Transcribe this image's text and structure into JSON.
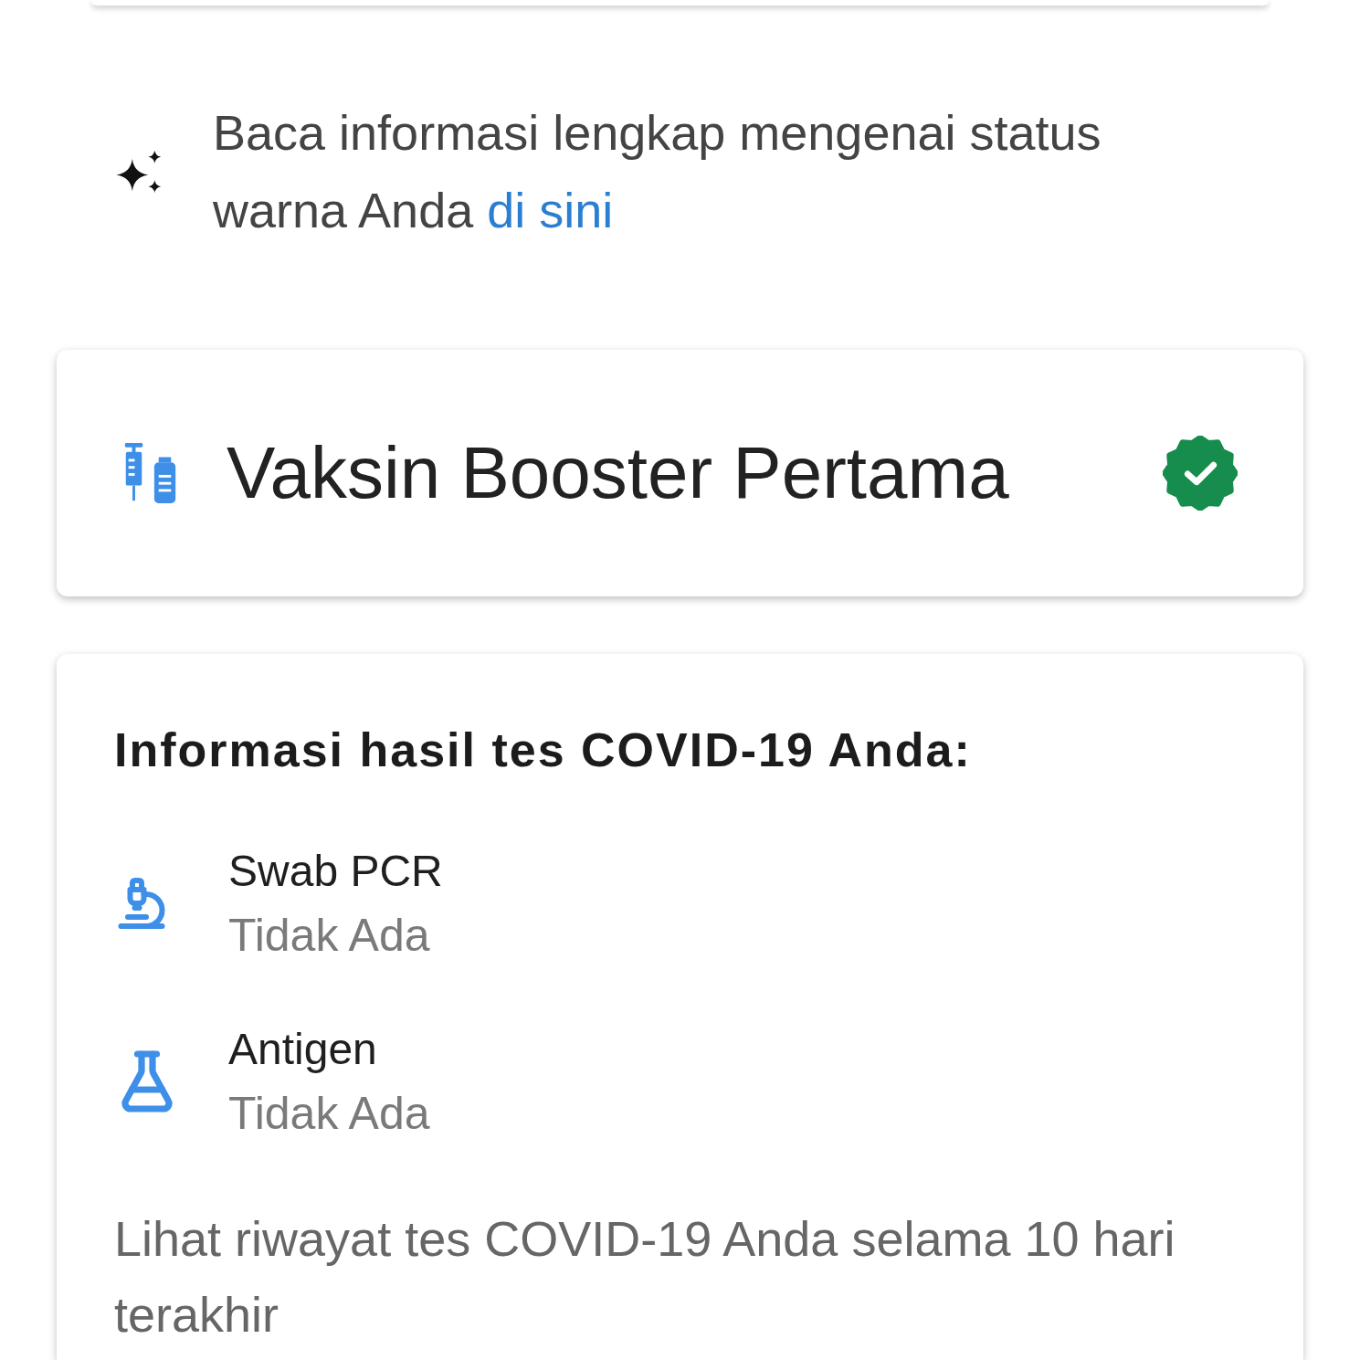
{
  "info": {
    "text": "Baca informasi lengkap mengenai status warna Anda",
    "link": "di sini"
  },
  "vaccine_card": {
    "title": "Vaksin Booster Pertama",
    "verified": true
  },
  "test_card": {
    "heading": "Informasi hasil tes COVID-19 Anda:",
    "tests": [
      {
        "kind": "pcr",
        "name": "Swab PCR",
        "result": "Tidak Ada"
      },
      {
        "kind": "antigen",
        "name": "Antigen",
        "result": "Tidak Ada"
      }
    ],
    "history_text": "Lihat riwayat tes COVID-19 Anda selama 10 hari terakhir"
  }
}
